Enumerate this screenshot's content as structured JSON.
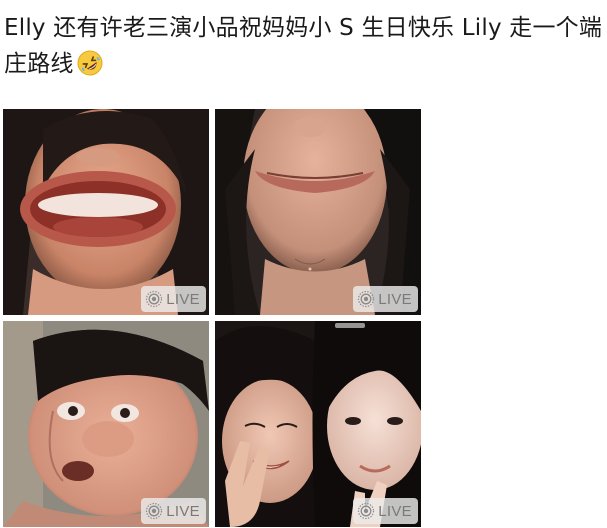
{
  "post": {
    "text": "Elly 还有许老三演小品祝妈妈小 S 生日快乐 Lily 走一个端庄路线",
    "emoji_icon": "rolling-on-floor-laughing-icon"
  },
  "photos": [
    {
      "badge": "LIVE",
      "badge_icon": "live-photo-icon"
    },
    {
      "badge": "LIVE",
      "badge_icon": "live-photo-icon"
    },
    {
      "badge": "LIVE",
      "badge_icon": "live-photo-icon"
    },
    {
      "badge": "LIVE",
      "badge_icon": "live-photo-icon"
    }
  ],
  "colors": {
    "text": "#1a1a1a",
    "badge_bg": "#ebebeb",
    "badge_text": "#7a7a7a"
  }
}
